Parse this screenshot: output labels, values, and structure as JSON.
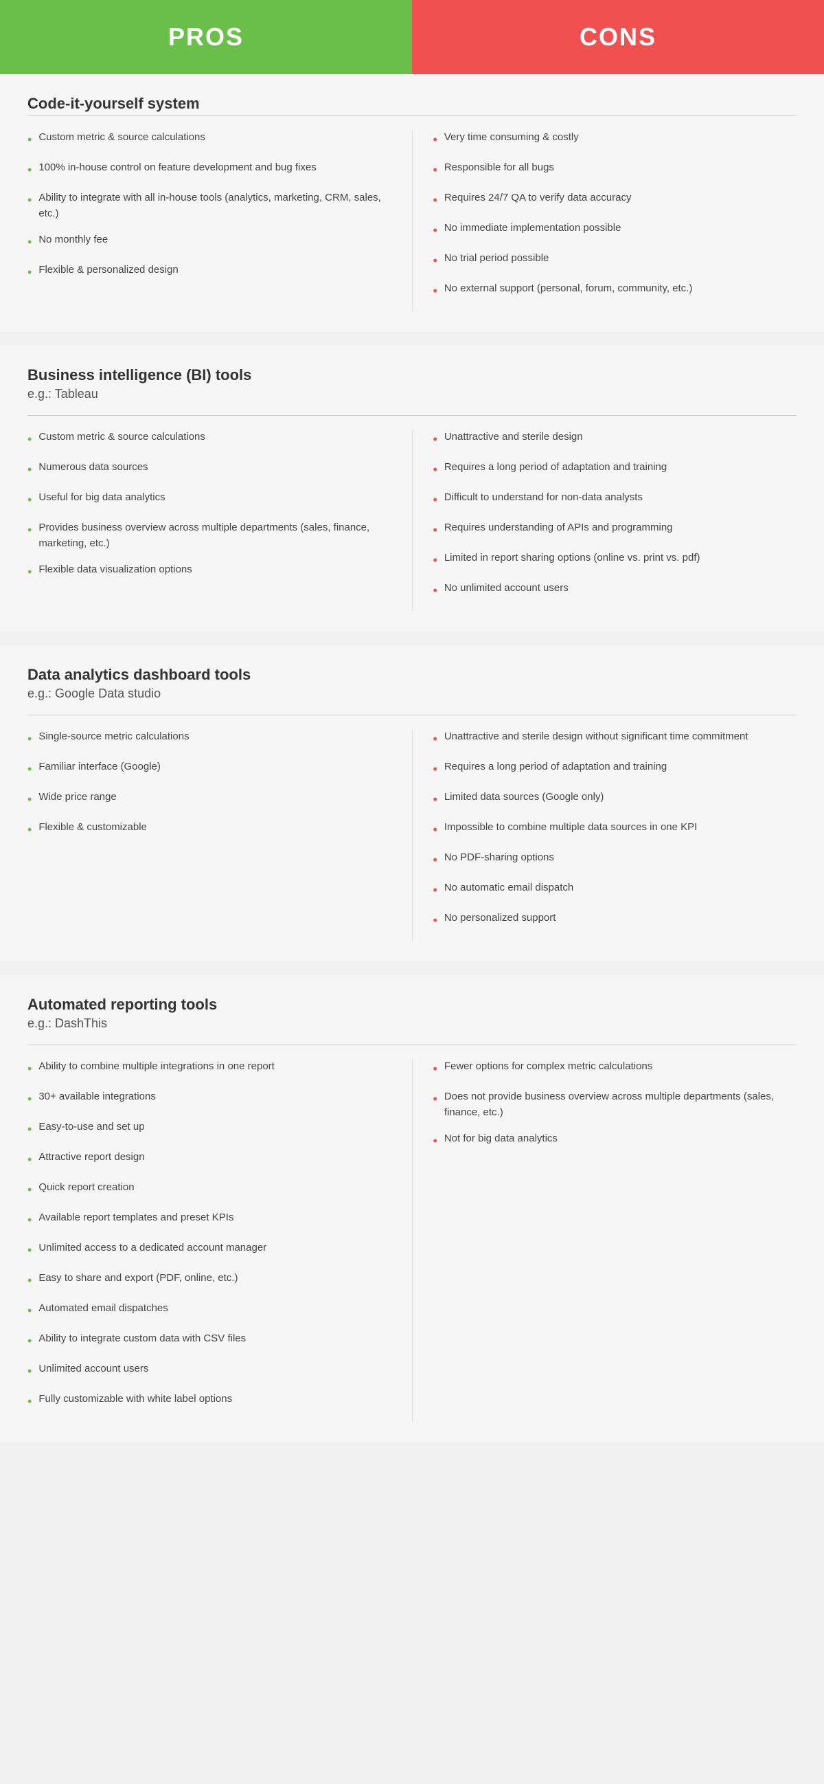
{
  "header": {
    "pros_label": "PROS",
    "cons_label": "CONS"
  },
  "sections": [
    {
      "id": "code-it-yourself",
      "title": "Code-it-yourself system",
      "subtitle": null,
      "pros": [
        "Custom metric & source calculations",
        "100% in-house control on feature development and bug fixes",
        "Ability to integrate with all in-house tools (analytics, marketing, CRM, sales, etc.)",
        "No monthly fee",
        "Flexible & personalized design"
      ],
      "cons": [
        "Very time consuming & costly",
        "Responsible for all bugs",
        "Requires 24/7 QA to verify data accuracy",
        "No immediate implementation possible",
        "No trial period possible",
        "No external support (personal, forum, community, etc.)"
      ]
    },
    {
      "id": "bi-tools",
      "title": "Business intelligence (BI) tools",
      "subtitle": "e.g.: Tableau",
      "pros": [
        "Custom metric & source calculations",
        "Numerous data sources",
        "Useful for big data analytics",
        "Provides business overview across multiple departments (sales, finance, marketing, etc.)",
        "Flexible data visualization options"
      ],
      "cons": [
        "Unattractive and sterile design",
        "Requires a long period of adaptation and training",
        "Difficult to understand for non-data analysts",
        "Requires understanding of APIs and programming",
        "Limited in report sharing options (online vs. print vs. pdf)",
        "No unlimited account users"
      ]
    },
    {
      "id": "data-analytics",
      "title": "Data analytics dashboard tools",
      "subtitle": "e.g.: Google Data studio",
      "pros": [
        "Single-source metric calculations",
        "Familiar interface (Google)",
        "Wide price range",
        "Flexible & customizable"
      ],
      "cons": [
        "Unattractive and sterile design without significant time commitment",
        "Requires a long period of adaptation and training",
        "Limited data sources (Google only)",
        "Impossible to combine multiple data sources in one KPI",
        "No PDF-sharing options",
        "No automatic email dispatch",
        "No personalized support"
      ]
    },
    {
      "id": "automated-reporting",
      "title": "Automated reporting tools",
      "subtitle": "e.g.: DashThis",
      "pros": [
        "Ability to combine multiple integrations in one report",
        "30+ available integrations",
        "Easy-to-use and set up",
        "Attractive report design",
        "Quick report creation",
        "Available report templates and preset KPIs",
        "Unlimited access to a dedicated account manager",
        "Easy to share and export (PDF, online, etc.)",
        "Automated email dispatches",
        "Ability to integrate custom data with CSV files",
        "Unlimited account users",
        "Fully customizable with white label options"
      ],
      "cons": [
        "Fewer options for complex metric calculations",
        "Does not provide business overview across multiple departments (sales, finance, etc.)",
        "Not for big data analytics"
      ]
    }
  ]
}
